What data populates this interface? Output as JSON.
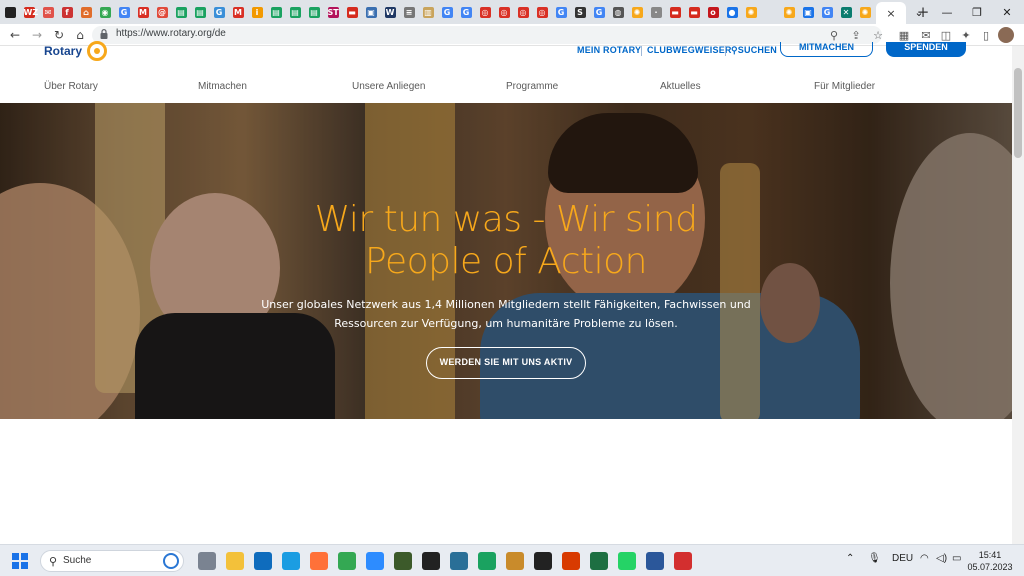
{
  "browser": {
    "tabs": [
      {
        "icon": "circle-icon",
        "color": "#222222",
        "glyph": ""
      },
      {
        "icon": "wz-icon",
        "color": "#d52b1e",
        "glyph": "WZ"
      },
      {
        "icon": "mail-icon",
        "color": "#e0524a",
        "glyph": "✉"
      },
      {
        "icon": "square-icon",
        "color": "#cc3333",
        "glyph": "f"
      },
      {
        "icon": "home-icon",
        "color": "#e06d2b",
        "glyph": "⌂"
      },
      {
        "icon": "maps-icon",
        "color": "#34a853",
        "glyph": "◉"
      },
      {
        "icon": "google-icon",
        "color": "#4285f4",
        "glyph": "G"
      },
      {
        "icon": "gmail-icon",
        "color": "#d93025",
        "glyph": "M"
      },
      {
        "icon": "at-icon",
        "color": "#e04a3a",
        "glyph": "@"
      },
      {
        "icon": "calendar-icon",
        "color": "#1aa260",
        "glyph": "▤"
      },
      {
        "icon": "calendar-icon",
        "color": "#1aa260",
        "glyph": "▤"
      },
      {
        "icon": "translate-icon",
        "color": "#3a8fd8",
        "glyph": "G"
      },
      {
        "icon": "gmail-icon",
        "color": "#d93025",
        "glyph": "M"
      },
      {
        "icon": "info-icon",
        "color": "#f29900",
        "glyph": "i"
      },
      {
        "icon": "sheets-icon",
        "color": "#1aa260",
        "glyph": "▤"
      },
      {
        "icon": "sheets-icon",
        "color": "#1aa260",
        "glyph": "▤"
      },
      {
        "icon": "sheets-icon",
        "color": "#1aa260",
        "glyph": "▤"
      },
      {
        "icon": "st-icon",
        "color": "#b3125a",
        "glyph": "ST"
      },
      {
        "icon": "flag-icon",
        "color": "#d52b1e",
        "glyph": "▬"
      },
      {
        "icon": "doc-icon",
        "color": "#3a6fb0",
        "glyph": "▣"
      },
      {
        "icon": "w-icon",
        "color": "#1f3864",
        "glyph": "W"
      },
      {
        "icon": "news-icon",
        "color": "#777777",
        "glyph": "≡"
      },
      {
        "icon": "book-icon",
        "color": "#c9a45c",
        "glyph": "▥"
      },
      {
        "icon": "google-icon",
        "color": "#4285f4",
        "glyph": "G"
      },
      {
        "icon": "google-icon",
        "color": "#4285f4",
        "glyph": "G"
      },
      {
        "icon": "target-icon",
        "color": "#d93025",
        "glyph": "◎"
      },
      {
        "icon": "target-icon",
        "color": "#d93025",
        "glyph": "◎"
      },
      {
        "icon": "target-icon",
        "color": "#d93025",
        "glyph": "◎"
      },
      {
        "icon": "target-icon",
        "color": "#d93025",
        "glyph": "◎"
      },
      {
        "icon": "google-icon",
        "color": "#4285f4",
        "glyph": "G"
      },
      {
        "icon": "s-icon",
        "color": "#333333",
        "glyph": "S"
      },
      {
        "icon": "google-icon",
        "color": "#4285f4",
        "glyph": "G"
      },
      {
        "icon": "globe-icon",
        "color": "#555555",
        "glyph": "◍"
      },
      {
        "icon": "rotary-icon",
        "color": "#f7a81b",
        "glyph": "✺"
      },
      {
        "icon": "dot-icon",
        "color": "#888888",
        "glyph": "·"
      },
      {
        "icon": "flag-icon",
        "color": "#d52b1e",
        "glyph": "▬"
      },
      {
        "icon": "flag-icon",
        "color": "#d52b1e",
        "glyph": "▬"
      },
      {
        "icon": "orf-icon",
        "color": "#c4161c",
        "glyph": "o"
      },
      {
        "icon": "user-icon",
        "color": "#1a73e8",
        "glyph": "●"
      },
      {
        "icon": "rotary-icon",
        "color": "#f7a81b",
        "glyph": "✺"
      },
      {
        "icon": "blank-icon",
        "color": "#dfe3e8",
        "glyph": ""
      },
      {
        "icon": "rotary-icon",
        "color": "#f7a81b",
        "glyph": "✺"
      },
      {
        "icon": "calendar-icon",
        "color": "#1a73e8",
        "glyph": "▣"
      },
      {
        "icon": "google-icon",
        "color": "#4285f4",
        "glyph": "G"
      },
      {
        "icon": "xing-icon",
        "color": "#0a7c6e",
        "glyph": "✕"
      },
      {
        "icon": "rotary-icon",
        "color": "#f7a81b",
        "glyph": "✺"
      }
    ],
    "active_tab_close": "×",
    "new_tab": "+",
    "url": "https://www.rotary.org/de"
  },
  "site": {
    "logo_text": "Rotary",
    "utility": {
      "mein_rotary": "MEIN ROTARY",
      "clubwegweiser": "CLUBWEGWEISER",
      "suchen": "SUCHEN",
      "mitmachen": "MITMACHEN",
      "spenden": "SPENDEN"
    },
    "nav": [
      "Über Rotary",
      "Mitmachen",
      "Unsere Anliegen",
      "Programme",
      "Aktuelles",
      "Für Mitglieder"
    ]
  },
  "hero": {
    "title_line1": "Wir tun was - Wir sind",
    "title_line2": "People of Action",
    "subtitle_line1": "Unser globales Netzwerk aus 1,4 Millionen Mitgliedern stellt Fähigkeiten, Fachwissen und",
    "subtitle_line2": "Ressourcen zur Verfügung, um humanitäre Probleme zu lösen.",
    "cta": "WERDEN SIE MIT UNS AKTIV"
  },
  "taskbar": {
    "search_label": "Suche",
    "language": "DEU",
    "time": "15:41",
    "date": "05.07.2023",
    "apps": [
      {
        "name": "task-view-icon",
        "color": "#7a8391"
      },
      {
        "name": "file-explorer-icon",
        "color": "#f3c13a"
      },
      {
        "name": "outlook-icon",
        "color": "#0f6cbd"
      },
      {
        "name": "edge-icon",
        "color": "#1b9de2"
      },
      {
        "name": "firefox-icon",
        "color": "#ff7139"
      },
      {
        "name": "chrome-icon",
        "color": "#34a853"
      },
      {
        "name": "zoom-icon",
        "color": "#2d8cff"
      },
      {
        "name": "network-tool-icon",
        "color": "#3c5a2a"
      },
      {
        "name": "solitaire-icon",
        "color": "#222222"
      },
      {
        "name": "windows-tool-icon",
        "color": "#2a6f97"
      },
      {
        "name": "notes-icon",
        "color": "#1aa260"
      },
      {
        "name": "paint-icon",
        "color": "#c98b2b"
      },
      {
        "name": "github-icon",
        "color": "#222222"
      },
      {
        "name": "office-icon",
        "color": "#d83b01"
      },
      {
        "name": "excel-icon",
        "color": "#1d6f42"
      },
      {
        "name": "whatsapp-icon",
        "color": "#25d366"
      },
      {
        "name": "word-icon",
        "color": "#2b579a"
      },
      {
        "name": "acrobat-icon",
        "color": "#d32f2f"
      }
    ]
  },
  "colors": {
    "rotary_blue": "#0067c8",
    "rotary_gold": "#f7a81b"
  }
}
